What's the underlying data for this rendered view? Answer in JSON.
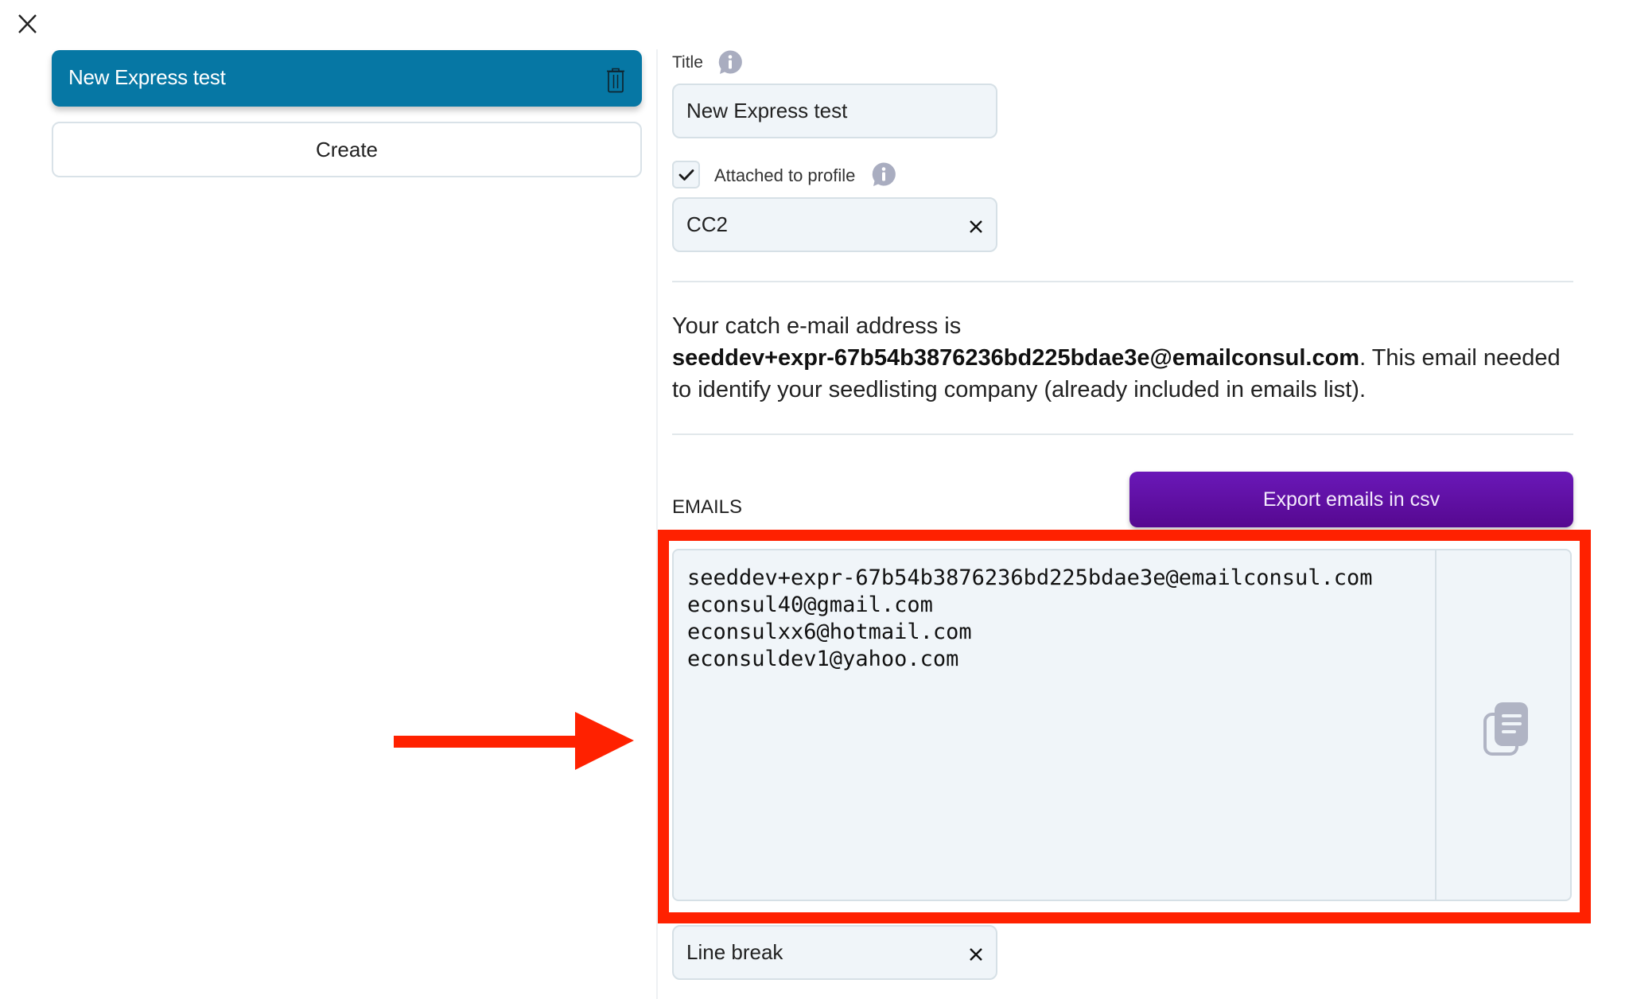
{
  "window": {
    "close_icon": "close-icon"
  },
  "sidebar": {
    "items": [
      {
        "label": "New Express test",
        "selected": true,
        "delete_icon": "trash-icon"
      }
    ],
    "create_label": "Create",
    "selected_color": "#0677a4"
  },
  "form": {
    "title_label": "Title",
    "title_value": "New Express test",
    "attached_label": "Attached to profile",
    "attached_checked": true,
    "profile_value": "CC2",
    "catch_prefix": "Your catch e-mail address is ",
    "catch_email": "seeddev+expr-67b54b3876236bd225bdae3e@emailconsul.com",
    "catch_suffix": ". This email needed to identify your seedlisting company (already included in emails list).",
    "emails_label": "EMAILS",
    "export_label": "Export emails in csv",
    "export_color": "#5f10a4",
    "emails": [
      "seeddev+expr-67b54b3876236bd225bdae3e@emailconsul.com",
      "econsul40@gmail.com",
      "econsulxx6@hotmail.com",
      "econsuldev1@yahoo.com"
    ],
    "emails_text": "seeddev+expr-67b54b3876236bd225bdae3e@emailconsul.com\neconsul40@gmail.com\neconsulxx6@hotmail.com\neconsuldev1@yahoo.com",
    "separator_value": "Line break",
    "copy_icon": "copy-icon",
    "info_icon": "info-icon"
  },
  "annotation": {
    "highlight_color": "#ff2100",
    "arrow_icon": "arrow-right-icon"
  }
}
